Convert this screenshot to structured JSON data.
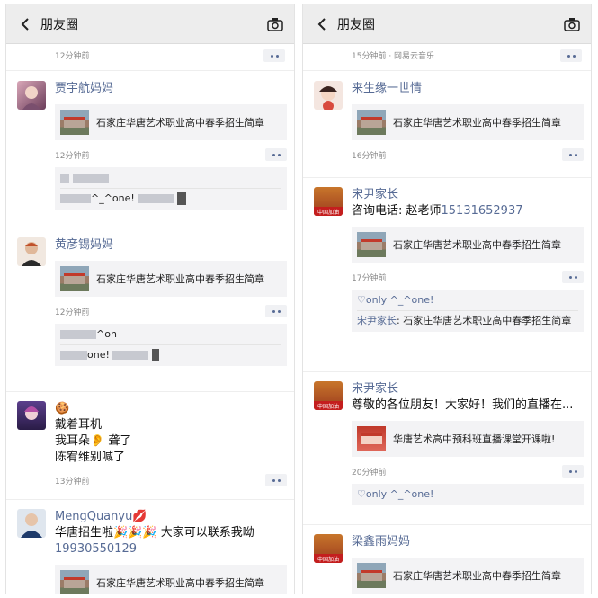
{
  "left": {
    "topbar": {
      "title": "朋友圈"
    },
    "partial_time": "12分钟前",
    "posts": [
      {
        "name": "贾宇航妈妈",
        "link": "石家庄华唐艺术职业高中春季招生简章",
        "time": "12分钟前",
        "comments": [
          "^_^one!"
        ]
      },
      {
        "name": "黄彦锡妈妈",
        "link": "石家庄华唐艺术职业高中春季招生简章",
        "time": "12分钟前",
        "comments": [
          "^on",
          "one!"
        ]
      },
      {
        "name": "🍪",
        "lines": [
          "戴着耳机",
          "我耳朵👂 聋了",
          "陈宥维别喊了"
        ],
        "time": "13分钟前"
      },
      {
        "name": "MengQuanyu💋",
        "lines": [
          "华唐招生啦🎉🎉🎉 大家可以联系我呦"
        ],
        "phone": "19930550129",
        "link": "石家庄华唐艺术职业高中春季招生简章"
      }
    ]
  },
  "right": {
    "topbar": {
      "title": "朋友圈"
    },
    "partial_time": "15分钟前 · 网易云音乐",
    "posts": [
      {
        "name": "来生缘一世情",
        "link": "石家庄华唐艺术职业高中春季招生简章",
        "time": "16分钟前"
      },
      {
        "name": "宋尹家长",
        "text_prefix": "咨询电话: 赵老师",
        "phone": "15131652937",
        "link": "石家庄华唐艺术职业高中春季招生简章",
        "time": "17分钟前",
        "comment_like": "♡only ^_^one!",
        "comment_author": "宋尹家长",
        "comment_text": ": 石家庄华唐艺术职业高中春季招生简章"
      },
      {
        "name": "宋尹家长",
        "text": "尊敬的各位朋友！大家好！我们的直播在...",
        "link": "华唐艺术高中预科班直播课堂开课啦!",
        "time": "20分钟前",
        "comment_like": "♡only ^_^one!"
      },
      {
        "name": "梁鑫雨妈妈",
        "link": "石家庄华唐艺术职业高中春季招生简章"
      }
    ]
  },
  "colors": {
    "name_blue": "#576b95",
    "topbar": "#ededed",
    "card_bg": "#f3f3f5"
  },
  "icons": {
    "back": "chevron-left-icon",
    "camera": "camera-icon",
    "more": "more-dots-icon"
  }
}
